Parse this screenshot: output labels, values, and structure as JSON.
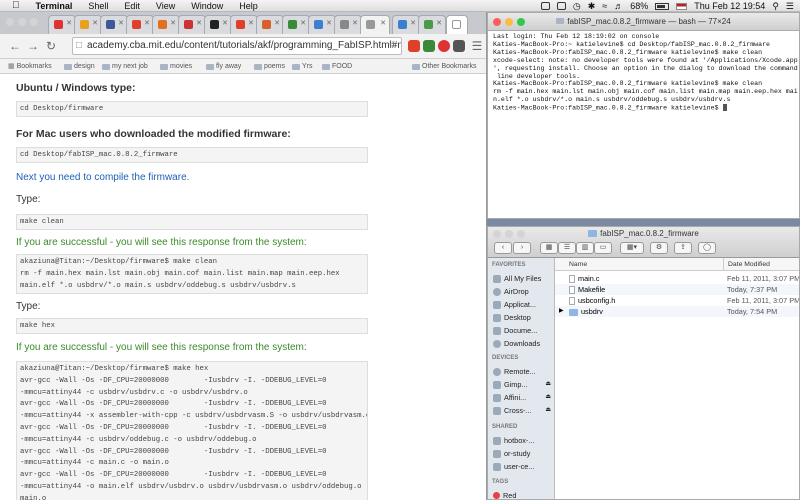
{
  "menubar": {
    "apple": "",
    "items": [
      "Terminal",
      "Shell",
      "Edit",
      "View",
      "Window",
      "Help"
    ],
    "battery": "68%",
    "clock": "Thu Feb 12  19:54"
  },
  "browser": {
    "url": "academy.cba.mit.edu/content/tutorials/akf/programming_FabISP.html#mac",
    "bookmarks": [
      "Bookmarks",
      "design",
      "my next job",
      "movies",
      "fly away",
      "poems",
      "Yrs",
      "FOOD",
      "Other Bookmarks"
    ],
    "page": {
      "heading1": "Ubuntu / Windows type:",
      "code1": "cd Desktop/firmware",
      "heading2": "For Mac users who downloaded the modified firmware:",
      "code2": "cd Desktop/fabISP_mac.0.8.2_firmware",
      "compile": "Next you need to compile the firmware.",
      "type1": "Type:",
      "code3": "make clean",
      "success1": "If you are successful - you will see this response from the system:",
      "code4": "akaziuna@Titan:~/Desktop/firmware$ make clean\nrm -f main.hex main.lst main.obj main.cof main.list main.map main.eep.hex\nmain.elf *.o usbdrv/*.o main.s usbdrv/oddebug.s usbdrv/usbdrv.s",
      "type2": "Type:",
      "code5": "make hex",
      "success2": "If you are successful - you will see this response from the system:",
      "code6": "akaziuna@Titan:~/Desktop/firmware$ make hex\navr-gcc -Wall -Os -DF_CPU=20000000        -Iusbdrv -I. -DDEBUG_LEVEL=0\n-mmcu=attiny44 -c usbdrv/usbdrv.c -o usbdrv/usbdrv.o\navr-gcc -Wall -Os -DF_CPU=20000000        -Iusbdrv -I. -DDEBUG_LEVEL=0\n-mmcu=attiny44 -x assembler-with-cpp -c usbdrv/usbdrvasm.S -o usbdrv/usbdrvasm.o\navr-gcc -Wall -Os -DF_CPU=20000000        -Iusbdrv -I. -DDEBUG_LEVEL=0\n-mmcu=attiny44 -c usbdrv/oddebug.c -o usbdrv/oddebug.o\navr-gcc -Wall -Os -DF_CPU=20000000        -Iusbdrv -I. -DDEBUG_LEVEL=0\n-mmcu=attiny44 -c main.c -o main.o\navr-gcc -Wall -Os -DF_CPU=20000000        -Iusbdrv -I. -DDEBUG_LEVEL=0\n-mmcu=attiny44 -o main.elf usbdrv/usbdrv.o usbdrv/usbdrvasm.o usbdrv/oddebug.o\nmain.o\nrm -f main.hex main.eep.hex"
    }
  },
  "terminal": {
    "title": "fabISP_mac.0.8.2_firmware — bash — 77×24",
    "lines": "Last login: Thu Feb 12 18:19:02 on console\nKaties-MacBook-Pro:~ katielevine$ cd Desktop/fabISP_mac.0.8.2_firmware\nKaties-MacBook-Pro:fabISP_mac.0.8.2_firmware katielevine$ make clean\nxcode-select: note: no developer tools were found at '/Applications/Xcode.app\n', requesting install. Choose an option in the dialog to download the command\n line developer tools.\nKaties-MacBook-Pro:fabISP_mac.0.8.2_firmware katielevine$ make clean\nrm -f main.hex main.lst main.obj main.cof main.list main.map main.eep.hex mai\nn.elf *.o usbdrv/*.o main.s usbdrv/oddebug.s usbdrv/usbdrv.s\nKaties-MacBook-Pro:fabISP_mac.0.8.2_firmware katielevine$ "
  },
  "finder": {
    "title": "fabISP_mac.0.8.2_firmware",
    "sections": {
      "favorites": "FAVORITES",
      "devices": "DEVICES",
      "shared": "SHARED",
      "tags": "TAGS"
    },
    "favorites": [
      "All My Files",
      "AirDrop",
      "Applicat...",
      "Desktop",
      "Docume...",
      "Downloads"
    ],
    "devices": [
      "Remote...",
      "Gimp...",
      "Affini...",
      "Cross-..."
    ],
    "shared": [
      "hotbox-...",
      "or-study",
      "user-ce..."
    ],
    "tags": [
      "Red"
    ],
    "columns": {
      "name": "Name",
      "date": "Date Modified"
    },
    "files": [
      {
        "name": "main.c",
        "date": "Feb 11, 2011, 3:07 PM"
      },
      {
        "name": "Makefile",
        "date": "Today, 7:37 PM"
      },
      {
        "name": "usbconfig.h",
        "date": "Feb 11, 2011, 3:07 PM"
      },
      {
        "name": "usbdrv",
        "date": "Today, 7:54 PM"
      }
    ]
  }
}
